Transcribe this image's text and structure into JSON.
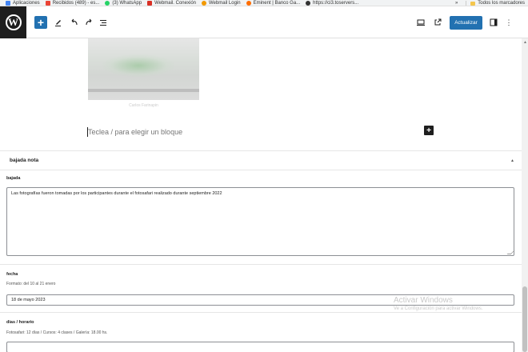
{
  "bookmarks": {
    "items": [
      {
        "label": "Aplicaciones",
        "color": "#4285f4"
      },
      {
        "label": "Recibidos (489) - es...",
        "color": "#ea4335"
      },
      {
        "label": "(3) WhatsApp",
        "color": "#25d366"
      },
      {
        "label": "Webmail. Conexión",
        "color": "#d93025"
      },
      {
        "label": "Webmail Login",
        "color": "#f29900"
      },
      {
        "label": "Eminent | Banco Ga...",
        "color": "#ff6d00"
      },
      {
        "label": "https://ci3.toservers...",
        "color": "#333333"
      }
    ],
    "overflow": "»",
    "all_bookmarks": "Todos los marcadores"
  },
  "toolbar": {
    "logo": "W",
    "add": "+",
    "tools_icon": "pencil-icon",
    "undo_icon": "undo-icon",
    "redo_icon": "redo-icon",
    "list_view_icon": "list-view-icon",
    "update_label": "Actualizar",
    "accent": "#2271b1"
  },
  "editor": {
    "image_caption": "Carlos Farinapin",
    "block_placeholder": "Teclea / para elegir un bloque",
    "inserter": "+"
  },
  "metabox": {
    "title": "bajada nota",
    "toggle": "▲",
    "fields": {
      "bajada": {
        "label": "bajada",
        "value": "Las fotografías fueron tomadas por los participantes durante el fotosafari realizado durante septiembre 2022"
      },
      "fecha": {
        "label": "fecha",
        "description": "Formato: del 10 al 21 enero",
        "value": "18 de mayo 2023"
      },
      "horario": {
        "label": "dias / horario",
        "description": "Fotosafari: 12 días / Cursos: 4 clases / Galería: 18.00 hs.",
        "value": ""
      }
    }
  },
  "watermark": {
    "line1": "Activar Windows",
    "line2": "Ve a Configuración para activar Windows."
  }
}
